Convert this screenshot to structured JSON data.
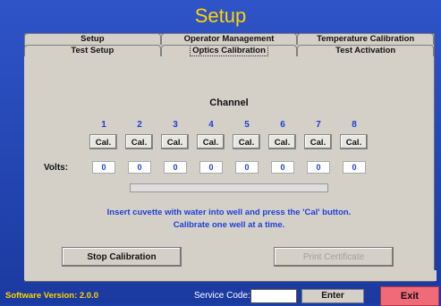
{
  "window": {
    "title": "Setup"
  },
  "tabs_row1": [
    {
      "label": "Setup"
    },
    {
      "label": "Operator Management"
    },
    {
      "label": "Temperature Calibration"
    }
  ],
  "tabs_row2": [
    {
      "label": "Test Setup"
    },
    {
      "label": "Optics Calibration",
      "active": true
    },
    {
      "label": "Test Activation"
    }
  ],
  "calibration": {
    "channel_label": "Channel",
    "channels": [
      "1",
      "2",
      "3",
      "4",
      "5",
      "6",
      "7",
      "8"
    ],
    "cal_button_label": "Cal.",
    "volts_label": "Volts:",
    "volts": [
      "0",
      "0",
      "0",
      "0",
      "0",
      "0",
      "0",
      "0"
    ],
    "progress_fraction": 0.0,
    "instruction_line1": "Insert cuvette with water into well and press the 'Cal' button.",
    "instruction_line2": "Calibrate one well at a time.",
    "stop_button": "Stop Calibration",
    "print_button": "Print Certificate"
  },
  "footer": {
    "version": "Software Version: 2.0.0",
    "service_code_label": "Service Code:",
    "service_code_value": "",
    "enter_button": "Enter",
    "exit_button": "Exit"
  },
  "colors": {
    "title": "#ffd400",
    "accent": "#1f3fd6",
    "exit": "#f06a78"
  }
}
